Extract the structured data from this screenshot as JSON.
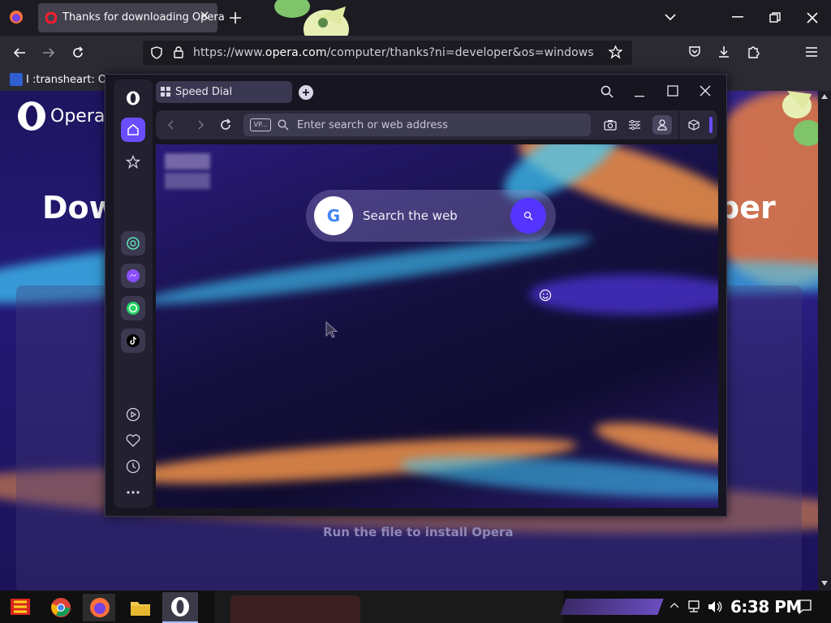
{
  "firefox": {
    "tab_title": "Thanks for downloading Opera",
    "url_prefix": "https://www.",
    "url_domain": "opera.com",
    "url_path": "/computer/thanks?ni=developer&os=windows",
    "bookmark_text": "I :transheart: OL"
  },
  "page": {
    "logo_text": "Opera",
    "heading_start": "Dow",
    "heading_end": "per",
    "run_text": "Run the file to install Opera"
  },
  "opera": {
    "tab_title": "Speed Dial",
    "vpn_label": "VP...",
    "address_placeholder": "Enter search or web address",
    "search_label": "Search the web",
    "google_letter": "G"
  },
  "taskbar": {
    "clock": "6:38 PM"
  },
  "colors": {
    "opera_accent": "#5534ff",
    "sidebar_active": "#6a4dff",
    "firefox_bg": "#1c1b22"
  }
}
